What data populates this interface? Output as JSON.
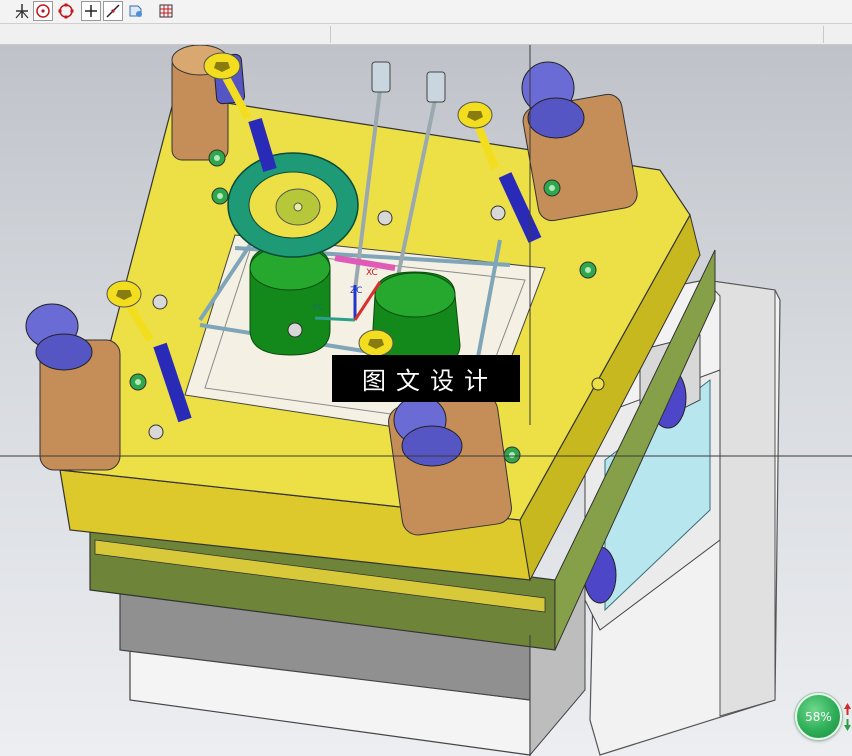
{
  "toolbar": {
    "icons": [
      "snap-point-icon",
      "circle-center-icon",
      "circle-quadrant-icon",
      "crosshair-icon",
      "line-measure-icon",
      "view-orient-icon",
      "grid-icon"
    ]
  },
  "viewport": {
    "overlay_caption": "图文设计",
    "axes": {
      "x_label": "XC",
      "y_label": "YC",
      "z_label": "ZC"
    }
  },
  "progress_badge": {
    "value_text": "58%",
    "value": 58
  },
  "colors": {
    "plate_yellow": "#e8d638",
    "plate_green": "#6f8a3a",
    "guide_bushing": "#c9955a",
    "leader_pin_cap": "#6b6bd6",
    "bolt_yellow": "#f2dd1e",
    "core_green": "#128a12",
    "locating_ring": "#1f9a78",
    "progress_green": "#2eae57"
  }
}
